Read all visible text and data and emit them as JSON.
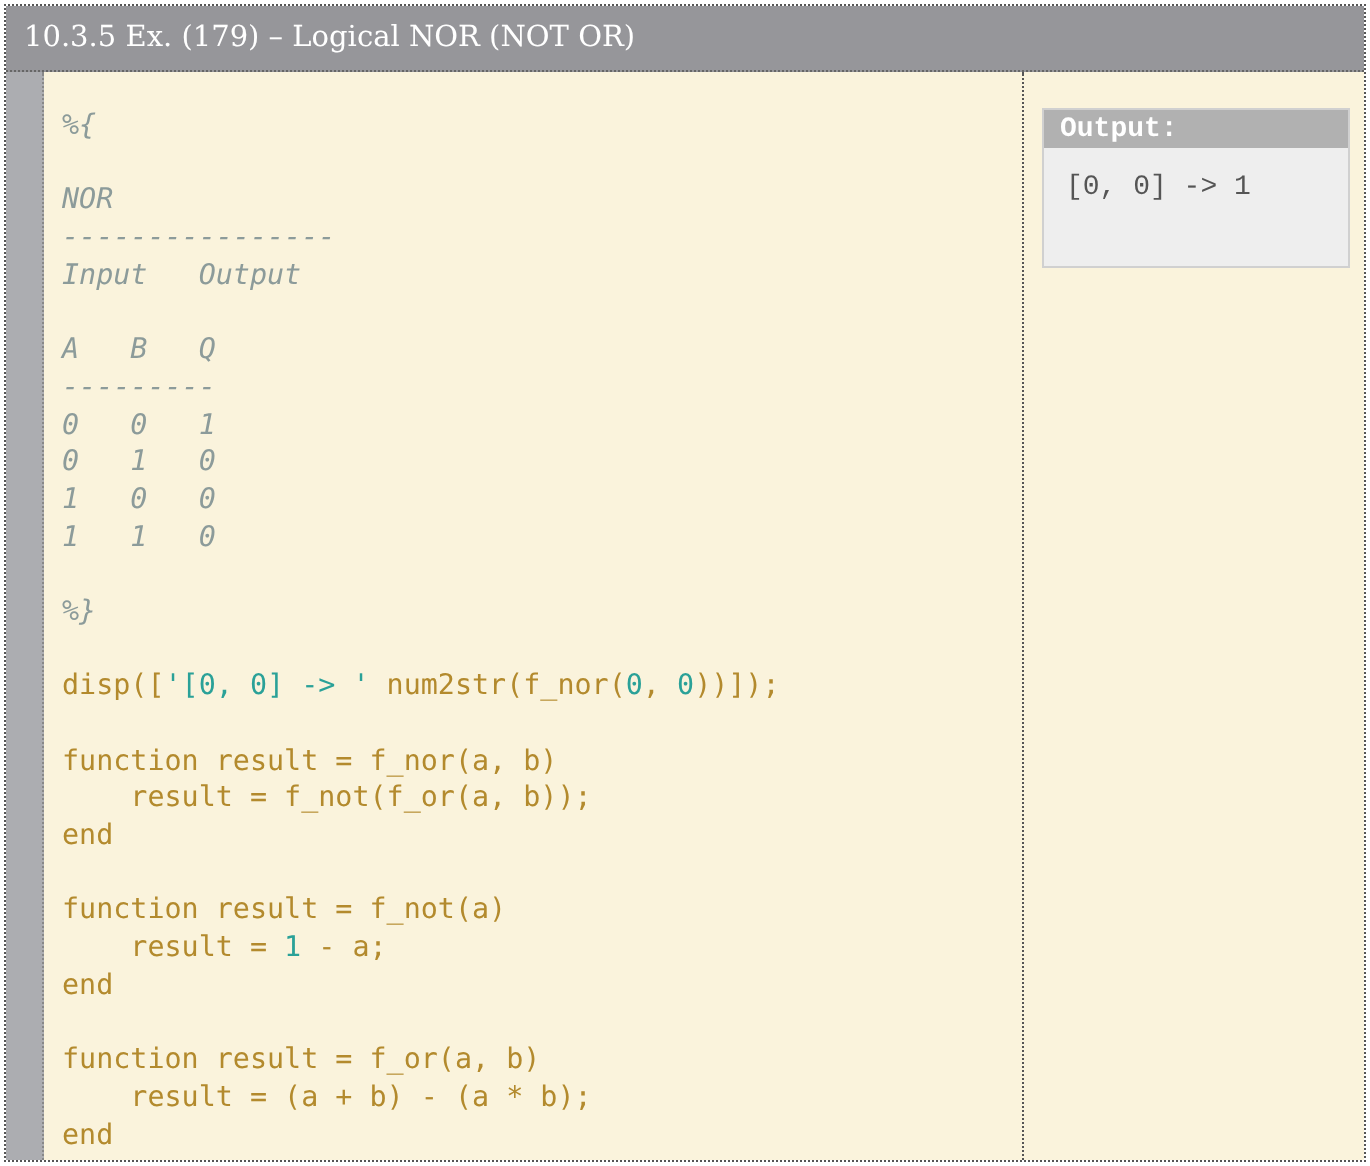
{
  "window": {
    "title": "10.3.5 Ex. (179) – Logical NOR (NOT OR)"
  },
  "code": [
    {
      "kind": "code",
      "tokens": [
        {
          "kind": "comment",
          "text": "%{"
        }
      ]
    },
    {
      "kind": "blank"
    },
    {
      "kind": "code",
      "tokens": [
        {
          "kind": "comment",
          "text": "NOR"
        }
      ]
    },
    {
      "kind": "code",
      "tokens": [
        {
          "kind": "comment",
          "text": "----------------"
        }
      ]
    },
    {
      "kind": "code",
      "tokens": [
        {
          "kind": "comment",
          "text": "Input   Output"
        }
      ]
    },
    {
      "kind": "blank"
    },
    {
      "kind": "code",
      "tokens": [
        {
          "kind": "comment",
          "text": "A   B   Q"
        }
      ]
    },
    {
      "kind": "code",
      "tokens": [
        {
          "kind": "comment",
          "text": "---------"
        }
      ]
    },
    {
      "kind": "code",
      "tokens": [
        {
          "kind": "comment",
          "text": "0   0   1"
        }
      ]
    },
    {
      "kind": "code",
      "tokens": [
        {
          "kind": "comment",
          "text": "0   1   0"
        }
      ]
    },
    {
      "kind": "code",
      "tokens": [
        {
          "kind": "comment",
          "text": "1   0   0"
        }
      ]
    },
    {
      "kind": "code",
      "tokens": [
        {
          "kind": "comment",
          "text": "1   1   0"
        }
      ]
    },
    {
      "kind": "blank"
    },
    {
      "kind": "code",
      "tokens": [
        {
          "kind": "comment",
          "text": "%}"
        }
      ]
    },
    {
      "kind": "blank"
    },
    {
      "kind": "code",
      "tokens": [
        {
          "kind": "plain",
          "text": "disp(["
        },
        {
          "kind": "string",
          "text": "'[0, 0] -> '"
        },
        {
          "kind": "plain",
          "text": " num2str(f_nor("
        },
        {
          "kind": "number",
          "text": "0"
        },
        {
          "kind": "plain",
          "text": ", "
        },
        {
          "kind": "number",
          "text": "0"
        },
        {
          "kind": "plain",
          "text": "))]);"
        }
      ]
    },
    {
      "kind": "blank"
    },
    {
      "kind": "code",
      "tokens": [
        {
          "kind": "plain",
          "text": "function result = f_nor(a, b)"
        }
      ]
    },
    {
      "kind": "code",
      "tokens": [
        {
          "kind": "plain",
          "text": "    result = f_not(f_or(a, b));"
        }
      ]
    },
    {
      "kind": "code",
      "tokens": [
        {
          "kind": "plain",
          "text": "end"
        }
      ]
    },
    {
      "kind": "blank"
    },
    {
      "kind": "code",
      "tokens": [
        {
          "kind": "plain",
          "text": "function result = f_not(a)"
        }
      ]
    },
    {
      "kind": "code",
      "tokens": [
        {
          "kind": "plain",
          "text": "    result = "
        },
        {
          "kind": "number",
          "text": "1"
        },
        {
          "kind": "plain",
          "text": " - a;"
        }
      ]
    },
    {
      "kind": "code",
      "tokens": [
        {
          "kind": "plain",
          "text": "end"
        }
      ]
    },
    {
      "kind": "blank"
    },
    {
      "kind": "code",
      "tokens": [
        {
          "kind": "plain",
          "text": "function result = f_or(a, b)"
        }
      ]
    },
    {
      "kind": "code",
      "tokens": [
        {
          "kind": "plain",
          "text": "    result = (a + b) - (a * b);"
        }
      ]
    },
    {
      "kind": "code",
      "tokens": [
        {
          "kind": "plain",
          "text": "end"
        }
      ]
    }
  ],
  "output": {
    "title": "Output:",
    "lines": [
      "[0, 0] -> 1"
    ]
  }
}
